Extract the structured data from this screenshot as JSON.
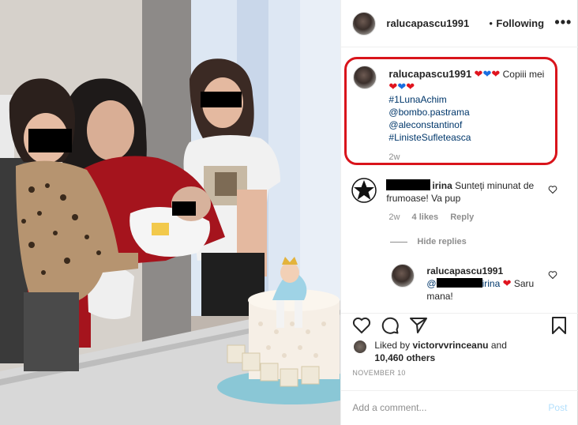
{
  "header": {
    "username": "ralucapascu1991",
    "dot": "•",
    "follow_status": "Following",
    "more": "•••"
  },
  "caption": {
    "username": "ralucapascu1991",
    "hearts1": [
      "red",
      "blue",
      "red"
    ],
    "text_after_hearts": "Copiii mei",
    "hearts2": [
      "red",
      "blue",
      "red"
    ],
    "hashtag1": "#1LunaAchim",
    "mention1": "@bombo.pastrama",
    "mention2": "@aleconstantinof",
    "hashtag2": "#LinisteSufleteasca",
    "time": "2w"
  },
  "comment": {
    "username_suffix": "irina",
    "text": "Sunteți minunat de frumoase! Va pup",
    "time": "2w",
    "likes": "4 likes",
    "reply": "Reply"
  },
  "hide_replies": "Hide replies",
  "reply": {
    "username": "ralucapascu1991",
    "mention_prefix": "@",
    "mention_suffix": "irina",
    "text": "Saru mana!"
  },
  "likes": {
    "liked_by": "Liked by",
    "user": "victorvvrinceanu",
    "and": "and",
    "others": "10,460 others"
  },
  "date": "NOVEMBER 10",
  "add_comment": {
    "placeholder": "Add a comment...",
    "post": "Post"
  },
  "colors": {
    "accent_red": "#d9141b",
    "heart_red": "#e0141e",
    "heart_blue": "#1a6ee0",
    "link": "#00376b",
    "post_disabled": "#b2dffc"
  }
}
